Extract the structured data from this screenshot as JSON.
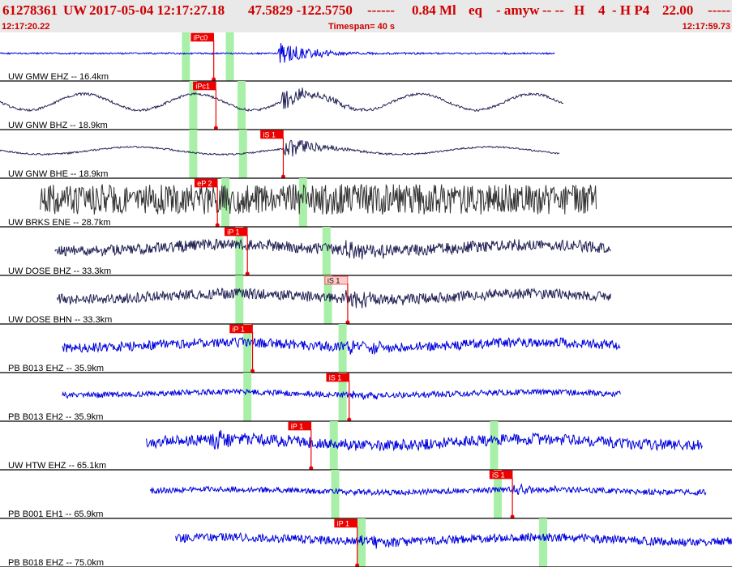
{
  "header": {
    "event_id": "61278361",
    "network": "UW",
    "origin": "2017-05-04 12:17:27.18",
    "location": "47.5829 -122.5750",
    "depth": "------",
    "magnitude": "0.84 Ml",
    "etype": "eq",
    "author": "- amyw",
    "flags1": "-- --",
    "flag_h": "H",
    "flag_4": "4",
    "flag_hp": "- H P4",
    "value": "22.00",
    "tail": "-----"
  },
  "timebar": {
    "start": "12:17:20.22",
    "span": "Timespan=  40 s",
    "end": "12:17:59.73"
  },
  "colors": {
    "header_bg": "#e9e9e9",
    "header_text": "#cc0000",
    "trace_blue": "#0000dd",
    "trace_dark": "#222255",
    "trace_gray": "#333333",
    "pick_red": "#ee0000",
    "pick_pink": "#ffcccc",
    "theory_green": "#a8f0a8"
  },
  "channels": [
    {
      "label": "UW GMW EHZ -- 16.4km",
      "color": "blue",
      "style": "spike",
      "amp": 0.9,
      "start": 0.0,
      "end": 0.758,
      "burst": 0.38,
      "pick": {
        "text": "iPc0",
        "t": 0.292,
        "pink": false
      },
      "green": [
        0.254,
        0.314
      ]
    },
    {
      "label": "UW GNW BHZ -- 18.9km",
      "color": "dark",
      "style": "wave",
      "amp": 0.7,
      "start": 0.0,
      "end": 0.77,
      "burst": 0.385,
      "pick": {
        "text": "iPc1",
        "t": 0.295,
        "pink": false
      },
      "green": [
        0.264,
        0.33
      ]
    },
    {
      "label": "UW GNW BHE -- 18.9km",
      "color": "dark",
      "style": "wave2",
      "amp": 0.5,
      "start": 0.0,
      "end": 0.765,
      "burst": 0.388,
      "pick": {
        "text": "iS 1",
        "t": 0.387,
        "pink": false
      },
      "green": [
        0.264,
        0.332
      ]
    },
    {
      "label": "UW BRKS ENE -- 28.7km",
      "color": "gray",
      "style": "noise",
      "amp": 0.85,
      "start": 0.055,
      "end": 0.815,
      "burst": 0.3,
      "pick": {
        "text": "eP 2",
        "t": 0.297,
        "pink": false
      },
      "green": [
        0.308,
        0.414
      ]
    },
    {
      "label": "UW DOSE BHZ -- 33.3km",
      "color": "dark",
      "style": "dense",
      "amp": 0.6,
      "start": 0.075,
      "end": 0.835,
      "burst": 0.47,
      "pick": {
        "text": "iP 1",
        "t": 0.338,
        "pink": false
      },
      "green": [
        0.327,
        0.446
      ]
    },
    {
      "label": "UW DOSE BHN -- 33.3km",
      "color": "dark",
      "style": "dense",
      "amp": 0.55,
      "start": 0.078,
      "end": 0.835,
      "burst": 0.47,
      "pick": {
        "text": "iS 1",
        "t": 0.475,
        "pink": true
      },
      "green": [
        0.327,
        0.448
      ]
    },
    {
      "label": "PB B013 EHZ -- 35.9km",
      "color": "blue",
      "style": "dense",
      "amp": 0.5,
      "start": 0.085,
      "end": 0.848,
      "burst": 0.47,
      "pick": {
        "text": "iP 1",
        "t": 0.345,
        "pink": false
      },
      "green": [
        0.338,
        0.468
      ]
    },
    {
      "label": "PB B013 EH2 -- 35.9km",
      "color": "blue",
      "style": "dense",
      "amp": 0.3,
      "start": 0.085,
      "end": 0.848,
      "burst": 0.475,
      "pick": {
        "text": "iS 1",
        "t": 0.477,
        "pink": false
      },
      "green": [
        0.338,
        0.468
      ]
    },
    {
      "label": "UW HTW EHZ -- 65.1km",
      "color": "blue",
      "style": "dense",
      "amp": 0.6,
      "start": 0.2,
      "end": 0.96,
      "burst": 0.285,
      "pick": {
        "text": "iP 1",
        "t": 0.425,
        "pink": false
      },
      "green": [
        0.456,
        0.675
      ]
    },
    {
      "label": "PB B001 EH1 -- 65.9km",
      "color": "blue",
      "style": "dense",
      "amp": 0.3,
      "start": 0.205,
      "end": 0.965,
      "burst": 0.7,
      "pick": {
        "text": "iS 1",
        "t": 0.7,
        "pink": false
      },
      "green": [
        0.458,
        0.68
      ]
    },
    {
      "label": "PB B018 EHZ -- 75.0km",
      "color": "blue",
      "style": "dense",
      "amp": 0.45,
      "start": 0.24,
      "end": 1.0,
      "burst": 0.49,
      "pick": {
        "text": "iP 1",
        "t": 0.488,
        "pink": false
      },
      "green": [
        0.494,
        0.742
      ]
    }
  ]
}
